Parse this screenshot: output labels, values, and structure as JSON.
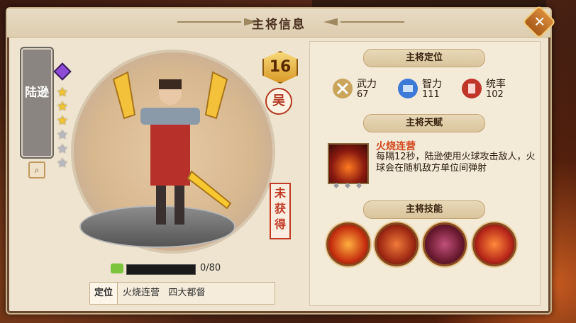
{
  "window": {
    "title": "主将信息",
    "close_label": "✕"
  },
  "hero": {
    "name": "陆逊",
    "stars_total": 6,
    "stars_filled": 3,
    "level": "16",
    "faction": "吴",
    "status": "未获得",
    "fragments": {
      "progress_text": "0/80",
      "current": 0,
      "total": 80
    }
  },
  "bottom": {
    "tag": "定位",
    "text": "火烧连营   四大都督"
  },
  "positioning": {
    "header": "主将定位",
    "stats": [
      {
        "label": "武力",
        "value": "67",
        "icon": "crossed-swords-icon",
        "color": "#c9a45a"
      },
      {
        "label": "智力",
        "value": "111",
        "icon": "scroll-icon",
        "color": "#3d7ad8"
      },
      {
        "label": "统率",
        "value": "102",
        "icon": "banner-icon",
        "color": "#c0342a"
      }
    ]
  },
  "talent": {
    "header": "主将天赋",
    "name": "火烧连营",
    "desc": "每隔12秒，陆逊使用火球攻击敌人，火球会在随机敌方单位间弹射"
  },
  "skills": {
    "header": "主将技能",
    "items": [
      {
        "icon": "fire-burst-skill-icon",
        "color": "#e04a18"
      },
      {
        "icon": "fire-rune-skill-icon",
        "color": "#b8321a"
      },
      {
        "icon": "fire-warrior-skill-icon",
        "color": "#8a2a40"
      },
      {
        "icon": "flame-strike-skill-icon",
        "color": "#d2401a"
      }
    ]
  }
}
